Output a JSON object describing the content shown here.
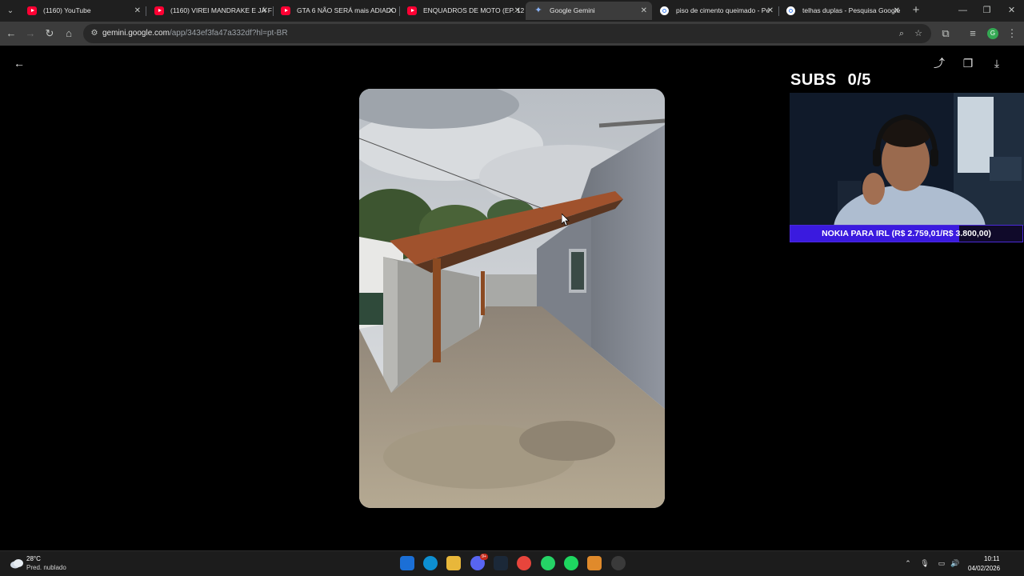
{
  "browser": {
    "tabs": [
      {
        "title": "(1160) YouTube",
        "favicon": "youtube-icon",
        "active": false
      },
      {
        "title": "(1160) VIREI MANDRAKE E JÁ F",
        "favicon": "youtube-icon",
        "active": false
      },
      {
        "title": "GTA 6 NÃO SERÁ mais ADIADO",
        "favicon": "youtube-icon",
        "active": false
      },
      {
        "title": "ENQUADROS DE MOTO (EP. 12",
        "favicon": "youtube-icon",
        "active": false
      },
      {
        "title": "Google Gemini",
        "favicon": "gemini-icon",
        "active": true
      },
      {
        "title": "piso de cimento queimado - Pe",
        "favicon": "google-icon",
        "active": false
      },
      {
        "title": "telhas duplas - Pesquisa Google",
        "favicon": "google-icon",
        "active": false
      }
    ],
    "url_host": "gemini.google.com",
    "url_path": "/app/343ef3fa47a332df?hl=pt-BR",
    "profile_initial": "G"
  },
  "stream_overlay": {
    "subs_label": "SUBS",
    "subs_count": "0/5",
    "goal_text": "NOKIA PARA IRL (R$ 2.759,01/R$ 3.800,00)",
    "goal_progress": 0.726
  },
  "taskbar": {
    "temperature": "28°C",
    "weather": "Pred. nublado",
    "time": "10:11",
    "date": "04/02/2026",
    "discord_badge": "9+"
  }
}
